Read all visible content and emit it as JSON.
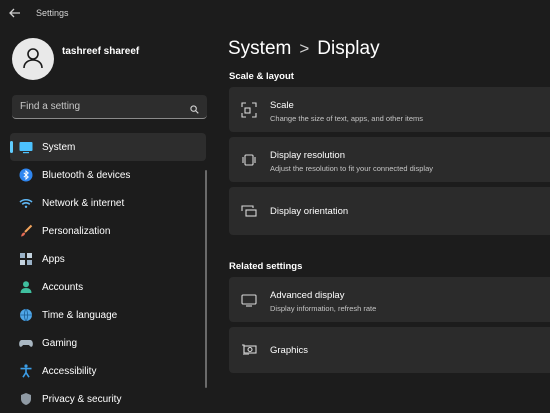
{
  "window": {
    "title": "Settings",
    "back_icon": "back-arrow-icon"
  },
  "user": {
    "name": "tashreef shareef",
    "avatar_icon": "person-icon"
  },
  "search": {
    "placeholder": "Find a setting",
    "value": "",
    "icon": "search-icon"
  },
  "sidebar": {
    "items": [
      {
        "label": "System",
        "icon": "monitor-icon",
        "selected": true
      },
      {
        "label": "Bluetooth & devices",
        "icon": "bluetooth-icon"
      },
      {
        "label": "Network & internet",
        "icon": "wifi-icon"
      },
      {
        "label": "Personalization",
        "icon": "brush-icon"
      },
      {
        "label": "Apps",
        "icon": "apps-icon"
      },
      {
        "label": "Accounts",
        "icon": "account-icon"
      },
      {
        "label": "Time & language",
        "icon": "globe-clock-icon"
      },
      {
        "label": "Gaming",
        "icon": "gamepad-icon"
      },
      {
        "label": "Accessibility",
        "icon": "accessibility-icon"
      },
      {
        "label": "Privacy & security",
        "icon": "shield-icon"
      }
    ]
  },
  "main": {
    "breadcrumb": {
      "parent": "System",
      "separator": ">",
      "current": "Display"
    },
    "scale_section": {
      "title": "Scale & layout",
      "cards": [
        {
          "title": "Scale",
          "subtitle": "Change the size of text, apps, and other items",
          "icon": "scale-icon"
        },
        {
          "title": "Display resolution",
          "subtitle": "Adjust the resolution to fit your connected display",
          "icon": "resolution-icon"
        },
        {
          "title": "Display orientation",
          "subtitle": "",
          "icon": "orientation-icon"
        }
      ]
    },
    "related_section": {
      "title": "Related settings",
      "cards": [
        {
          "title": "Advanced display",
          "subtitle": "Display information, refresh rate",
          "icon": "monitor-outline-icon"
        },
        {
          "title": "Graphics",
          "subtitle": "",
          "icon": "graphics-card-icon"
        }
      ]
    }
  },
  "colors": {
    "background": "#1c1c1c",
    "card": "#2b2b2b",
    "accent": "#60cdff",
    "selected": "#2d2d2d"
  }
}
